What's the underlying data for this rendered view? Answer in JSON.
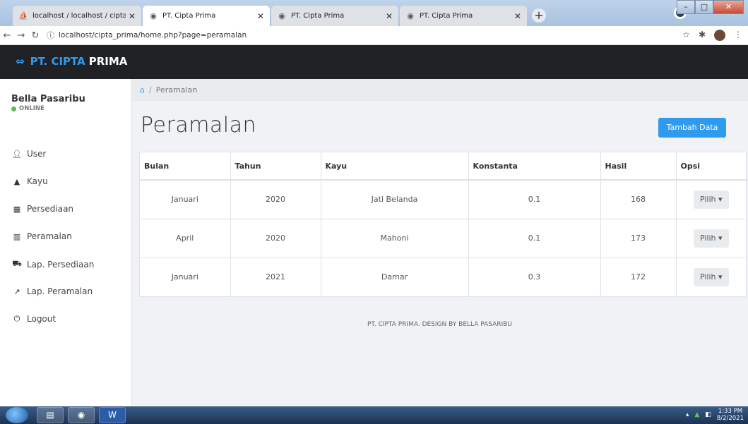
{
  "browser": {
    "tabs": [
      {
        "title": "localhost / localhost / cipta_prim",
        "icon": "phpmyadmin-icon"
      },
      {
        "title": "PT. Cipta Prima",
        "icon": "globe-icon"
      },
      {
        "title": "PT. Cipta Prima",
        "icon": "globe-icon"
      },
      {
        "title": "PT. Cipta Prima",
        "icon": "globe-icon"
      }
    ],
    "url": "localhost/cipta_prima/home.php?page=peramalan"
  },
  "brand": {
    "part1": "PT. CIPTA",
    "part2": "PRIMA"
  },
  "user": {
    "name": "Bella Pasaribu",
    "status": "ONLINE"
  },
  "sidebar": {
    "items": [
      {
        "label": "User",
        "icon": "user-icon"
      },
      {
        "label": "Kayu",
        "icon": "tree-icon"
      },
      {
        "label": "Persediaan",
        "icon": "calendar-icon"
      },
      {
        "label": "Peramalan",
        "icon": "bar-chart-icon"
      },
      {
        "label": "Lap. Persediaan",
        "icon": "cart-icon"
      },
      {
        "label": "Lap. Peramalan",
        "icon": "line-chart-icon"
      },
      {
        "label": "Logout",
        "icon": "power-icon"
      }
    ]
  },
  "breadcrumb": {
    "current": "Peramalan"
  },
  "page": {
    "title": "Peramalan",
    "add_button": "Tambah Data"
  },
  "table": {
    "headers": [
      "Bulan",
      "Tahun",
      "Kayu",
      "Konstanta",
      "Hasil",
      "Opsi"
    ],
    "rows": [
      {
        "bulan": "Januari",
        "tahun": "2020",
        "kayu": "Jati Belanda",
        "konstanta": "0.1",
        "hasil": "168",
        "opsi": "Pilih"
      },
      {
        "bulan": "April",
        "tahun": "2020",
        "kayu": "Mahoni",
        "konstanta": "0.1",
        "hasil": "173",
        "opsi": "Pilih"
      },
      {
        "bulan": "Januari",
        "tahun": "2021",
        "kayu": "Damar",
        "konstanta": "0.3",
        "hasil": "172",
        "opsi": "Pilih"
      }
    ]
  },
  "footer": "PT. CIPTA PRIMA. DESIGN BY BELLA PASARIBU",
  "taskbar": {
    "time": "1:33 PM",
    "date": "8/2/2021"
  }
}
